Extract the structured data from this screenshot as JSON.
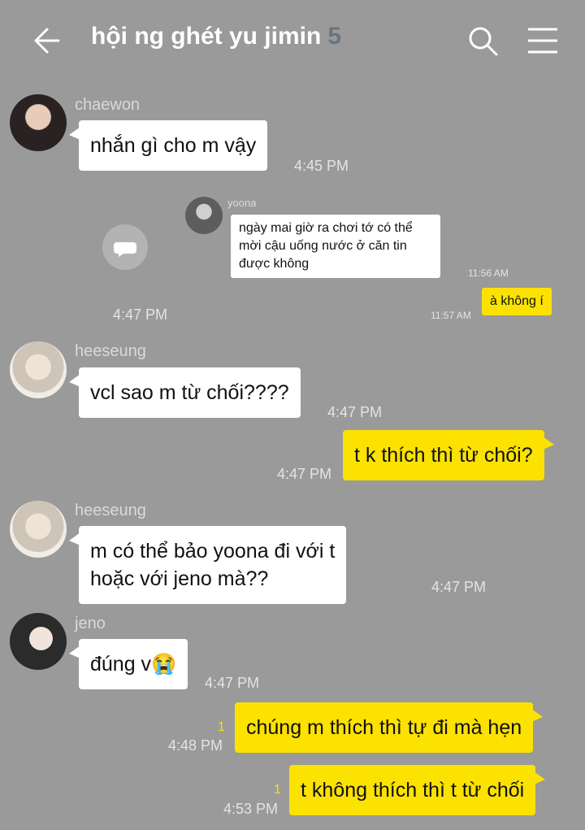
{
  "header": {
    "title": "hội ng ghét yu jimin",
    "member_count": "5"
  },
  "messages": {
    "m1": {
      "sender": "chaewon",
      "text": "nhắn gì cho m vậy",
      "time": "4:45 PM"
    },
    "m2": {
      "time": "4:47 PM",
      "screenshot": {
        "sender": "yoona",
        "text": "ngày mai giờ ra chơi tớ có thể mời cậu uống nước ở căn tin được không",
        "time": "11:56 AM",
        "reply_text": "à không í",
        "reply_time": "11:57 AM"
      }
    },
    "m3": {
      "sender": "heeseung",
      "text": "vcl sao m từ chối????",
      "time": "4:47 PM"
    },
    "m4": {
      "text": "t k thích thì từ chối?",
      "time": "4:47 PM"
    },
    "m5": {
      "sender": "heeseung",
      "line1": "m có thể bảo yoona đi với t",
      "line2": "hoặc với jeno mà??",
      "time": "4:47 PM"
    },
    "m6": {
      "sender": "jeno",
      "text": "đúng v",
      "emoji": "😭",
      "time": "4:47 PM"
    },
    "m7": {
      "text": "chúng m thích thì tự đi mà hẹn",
      "time": "4:48 PM",
      "unread": "1"
    },
    "m8": {
      "text": "t không thích thì t từ chối",
      "time": "4:53 PM",
      "unread": "1"
    }
  },
  "colors": {
    "background": "#9a9a9a",
    "my_bubble": "#fbe200",
    "their_bubble": "#ffffff"
  },
  "icons": [
    "back-arrow-icon",
    "search-icon",
    "menu-icon",
    "share-icon"
  ]
}
